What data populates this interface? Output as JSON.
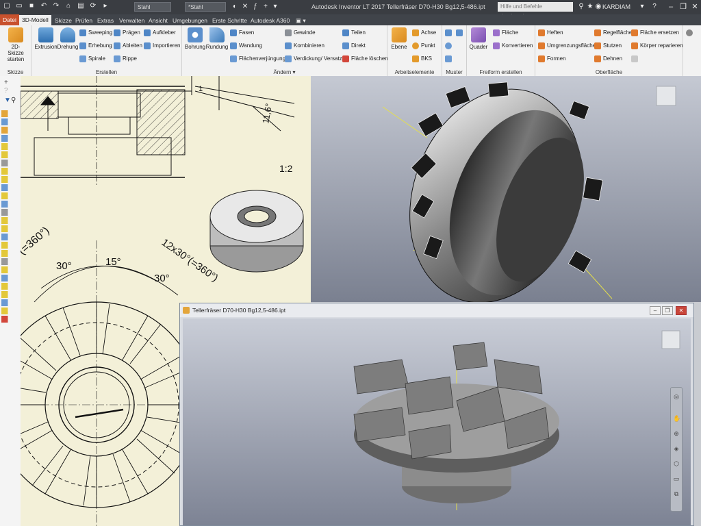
{
  "titlebar": {
    "material": "Stahl",
    "appearance": "*Stahl",
    "app_title": "Autodesk Inventor LT 2017   Tellerfräser D70-H30 Bg12,5-486.ipt",
    "help_placeholder": "Hilfe und Befehle durchsuchen...",
    "user": "KARDIAM"
  },
  "tabs": [
    "Datei",
    "3D-Modell",
    "Skizze",
    "Prüfen",
    "Extras",
    "Verwalten",
    "Ansicht",
    "Umgebungen",
    "Erste Schritte",
    "Autodesk A360"
  ],
  "ribbon": {
    "skizze": {
      "title": "Skizze",
      "btn": "2D-Skizze starten"
    },
    "erstellen": {
      "title": "Erstellen",
      "big": [
        "Extrusion",
        "Drehung"
      ],
      "col1": [
        "Sweeping",
        "Erhebung",
        "Spirale"
      ],
      "col2": [
        "Prägen",
        "Ableiten",
        "Rippe"
      ],
      "col3": [
        "Aufkleber",
        "Importieren"
      ]
    },
    "aendern": {
      "title": "Ändern",
      "big": [
        "Bohrung",
        "Rundung"
      ],
      "col1": [
        "Fasen",
        "Wandung",
        "Flächenverjüngung"
      ],
      "col2": [
        "Gewinde",
        "Kombinieren",
        "Verdickung/ Versatz"
      ],
      "col3": [
        "Teilen",
        "Direkt",
        "Fläche löschen"
      ]
    },
    "arbeitselemente": {
      "title": "Arbeitselemente",
      "big": "Ebene",
      "items": [
        "Achse",
        "Punkt",
        "BKS"
      ]
    },
    "muster": {
      "title": "Muster"
    },
    "freiform": {
      "title": "Freiform erstellen",
      "big": "Quader",
      "items": [
        "Fläche",
        "Konvertieren"
      ]
    },
    "oberflaeche": {
      "title": "Oberfläche",
      "col1": [
        "Heften",
        "Umgrenzungsfläche",
        "Formen"
      ],
      "col2": [
        "Regelfläche",
        "Stutzen",
        "Dehnen"
      ],
      "col3": [
        "Fläche ersetzen",
        "Körper reparieren"
      ]
    }
  },
  "drawing": {
    "scale_label": "1:2",
    "dim_angle_1": "11,6°",
    "dim_30_left": "30°",
    "dim_15": "15°",
    "dim_30_right": "30°",
    "dim_pattern_left": "(=360°)",
    "dim_pattern_right": "12x30°(=360°)"
  },
  "window2": {
    "title": "Tellerfräser D70-H30 Bg12,5-486.ipt"
  },
  "colors": {
    "file_tab": "#c8512d",
    "drawing_bg": "#f3f0d8",
    "ribbon_bg": "#f2f2f2"
  }
}
